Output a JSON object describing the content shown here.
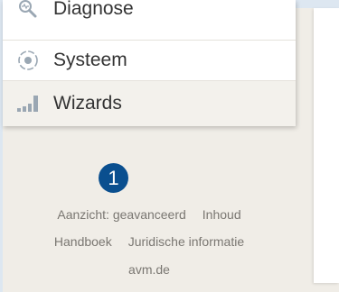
{
  "menu": {
    "items": [
      {
        "label": "Diagnose",
        "icon": "diagnose-icon"
      },
      {
        "label": "Systeem",
        "icon": "systeem-icon"
      },
      {
        "label": "Wizards",
        "icon": "wizards-icon"
      }
    ]
  },
  "badge": {
    "value": "1"
  },
  "footer": {
    "view_mode": "Aanzicht: geavanceerd",
    "contents": "Inhoud",
    "manual": "Handboek",
    "legal": "Juridische informatie",
    "website": "avm.de"
  },
  "colors": {
    "badge": "#0a4f8f",
    "background": "#f0ede7",
    "top_strip": "#dde7f1",
    "footer_text": "#7a7772",
    "menu_text": "#333333"
  }
}
